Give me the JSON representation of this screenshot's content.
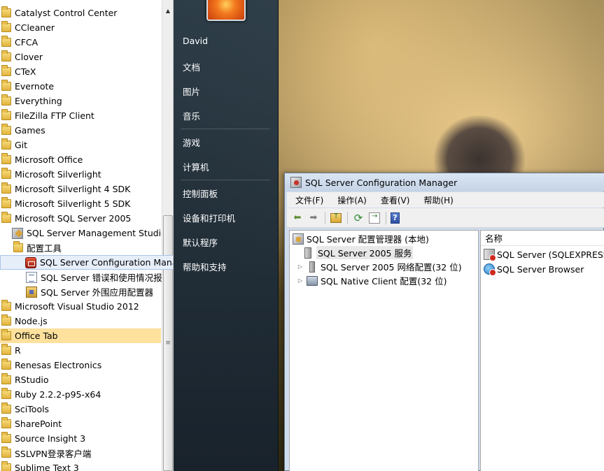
{
  "programs": {
    "items": [
      {
        "label": "Catalyst Control Center",
        "icon": "folder-icon"
      },
      {
        "label": "CCleaner",
        "icon": "folder-icon"
      },
      {
        "label": "CFCA",
        "icon": "folder-icon"
      },
      {
        "label": "Clover",
        "icon": "folder-icon"
      },
      {
        "label": "CTeX",
        "icon": "folder-icon"
      },
      {
        "label": "Evernote",
        "icon": "folder-icon"
      },
      {
        "label": "Everything",
        "icon": "folder-icon"
      },
      {
        "label": "FileZilla FTP Client",
        "icon": "folder-icon"
      },
      {
        "label": "Games",
        "icon": "folder-icon"
      },
      {
        "label": "Git",
        "icon": "folder-icon"
      },
      {
        "label": "Microsoft Office",
        "icon": "folder-icon"
      },
      {
        "label": "Microsoft Silverlight",
        "icon": "folder-icon"
      },
      {
        "label": "Microsoft Silverlight 4 SDK",
        "icon": "folder-icon"
      },
      {
        "label": "Microsoft Silverlight 5 SDK",
        "icon": "folder-icon"
      },
      {
        "label": "Microsoft SQL Server 2005",
        "icon": "folder-icon"
      },
      {
        "label": "SQL Server Management Studio",
        "icon": "ssms-icon"
      },
      {
        "label": "配置工具",
        "icon": "folder-icon"
      },
      {
        "label": "SQL Server Configuration Manager",
        "icon": "config-manager-icon"
      },
      {
        "label": "SQL Server 错误和使用情况报告",
        "icon": "error-report-icon"
      },
      {
        "label": "SQL Server 外围应用配置器",
        "icon": "surface-area-icon"
      },
      {
        "label": "Microsoft Visual Studio 2012",
        "icon": "folder-icon"
      },
      {
        "label": "Node.js",
        "icon": "folder-icon"
      },
      {
        "label": "Office Tab",
        "icon": "folder-icon"
      },
      {
        "label": "R",
        "icon": "folder-icon"
      },
      {
        "label": "Renesas Electronics",
        "icon": "folder-icon"
      },
      {
        "label": "RStudio",
        "icon": "folder-icon"
      },
      {
        "label": "Ruby 2.2.2-p95-x64",
        "icon": "folder-icon"
      },
      {
        "label": "SciTools",
        "icon": "folder-icon"
      },
      {
        "label": "SharePoint",
        "icon": "folder-icon"
      },
      {
        "label": "Source Insight 3",
        "icon": "folder-icon"
      },
      {
        "label": "SSLVPN登录客户端",
        "icon": "folder-icon"
      },
      {
        "label": "Sublime Text 3",
        "icon": "folder-icon"
      }
    ]
  },
  "start_menu": {
    "user": "David",
    "links": [
      "文档",
      "图片",
      "音乐",
      "游戏",
      "计算机",
      "控制面板",
      "设备和打印机",
      "默认程序",
      "帮助和支持"
    ]
  },
  "window": {
    "title": "SQL Server Configuration Manager",
    "menu": [
      "文件(F)",
      "操作(A)",
      "查看(V)",
      "帮助(H)"
    ],
    "toolbar_icons": [
      "back-arrow-icon",
      "forward-arrow-icon",
      "up-folder-icon",
      "refresh-icon",
      "export-icon",
      "help-icon"
    ],
    "tree": {
      "root": "SQL Server 配置管理器 (本地)",
      "nodes": [
        "SQL Server 2005 服务",
        "SQL Server 2005 网络配置(32 位)",
        "SQL Native Client 配置(32 位)"
      ]
    },
    "list": {
      "header": "名称",
      "items": [
        "SQL Server (SQLEXPRESS)",
        "SQL Server Browser"
      ]
    }
  },
  "colors": {
    "office_tab_highlight": "#fde19d",
    "selected_item_bg": "#e6eef9",
    "start_menu_right_bg": "#27394a"
  }
}
